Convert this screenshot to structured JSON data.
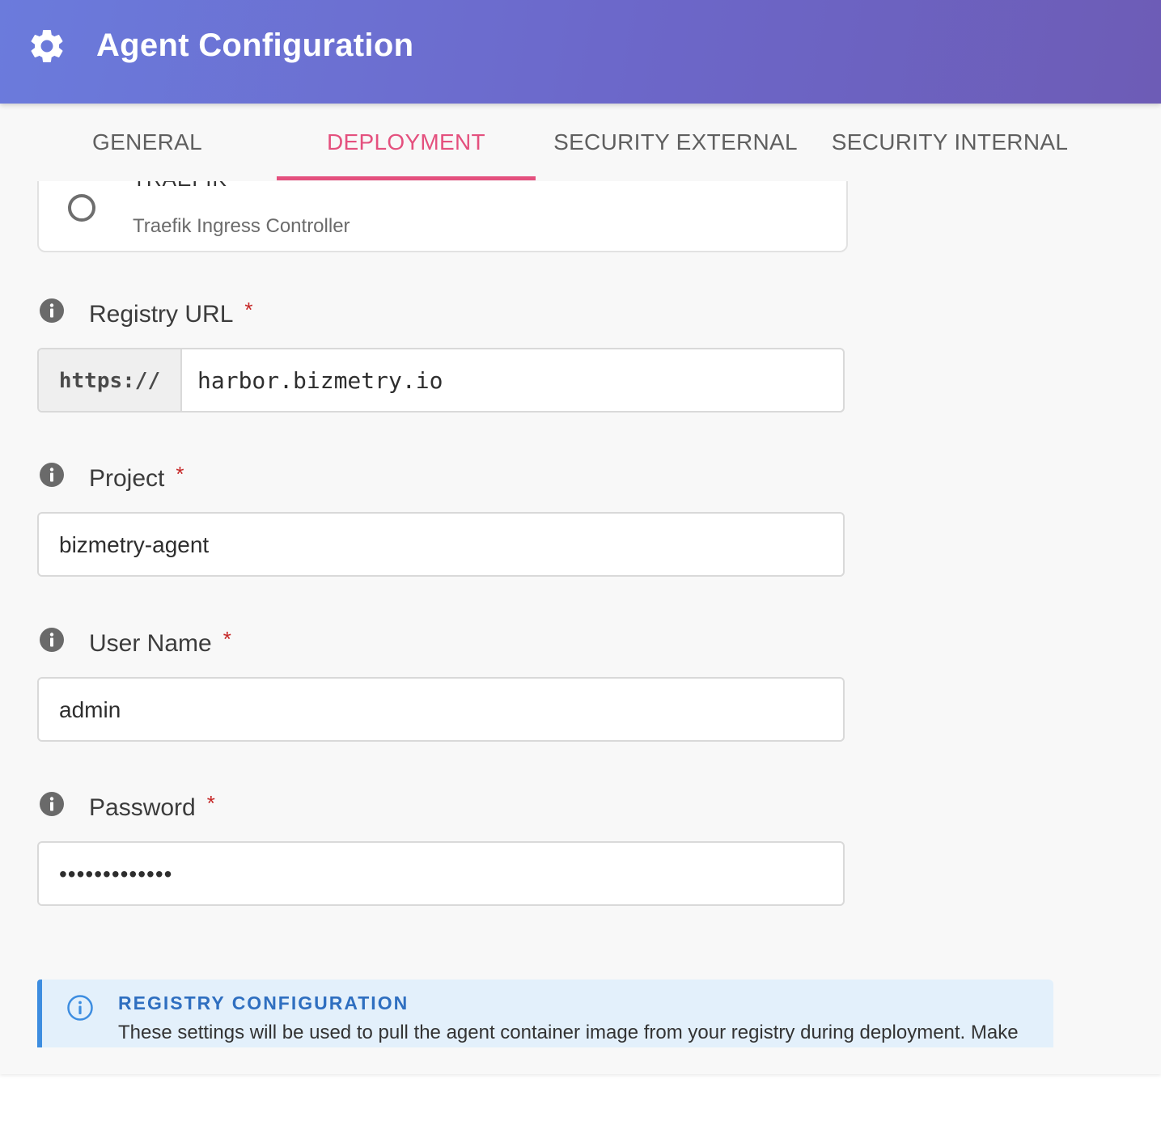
{
  "header": {
    "title": "Agent Configuration",
    "icon": "gear-icon"
  },
  "tabs": [
    {
      "label": "GENERAL",
      "active": false
    },
    {
      "label": "DEPLOYMENT",
      "active": true
    },
    {
      "label": "SECURITY EXTERNAL",
      "active": false
    },
    {
      "label": "SECURITY INTERNAL",
      "active": false
    }
  ],
  "ingress_option": {
    "title": "TRAEFIK",
    "subtitle": "Traefik Ingress Controller",
    "selected": false
  },
  "fields": {
    "registry_url": {
      "label": "Registry URL",
      "required_mark": "*",
      "prefix": "https://",
      "value": "harbor.bizmetry.io"
    },
    "project": {
      "label": "Project",
      "required_mark": "*",
      "value": "bizmetry-agent"
    },
    "user_name": {
      "label": "User Name",
      "required_mark": "*",
      "value": "admin"
    },
    "password": {
      "label": "Password",
      "required_mark": "*",
      "value": "•••••••••••••"
    }
  },
  "notice": {
    "title": "REGISTRY CONFIGURATION",
    "text": "These settings will be used to pull the agent container image from your registry during deployment. Make"
  },
  "colors": {
    "header_gradient_start": "#6b7bdc",
    "header_gradient_end": "#6d5cb6",
    "active_tab": "#e4507e",
    "required": "#c62828",
    "notice_accent": "#3d8de0",
    "notice_bg": "#e3f0fb"
  }
}
